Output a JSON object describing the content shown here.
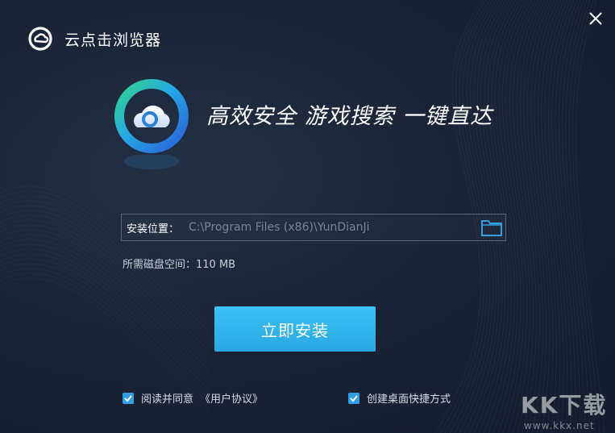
{
  "window": {
    "title": "云点击浏览器",
    "slogan": "高效安全  游戏搜索  一键直达"
  },
  "icons": {
    "app": "cloud-logo-icon",
    "close": "close-icon",
    "folder": "folder-icon",
    "check": "check-icon"
  },
  "install": {
    "path_label": "安装位置：",
    "path_value": "C:\\Program Files (x86)\\YunDianJi",
    "disk_space": "所需磁盘空间：110 MB",
    "button_label": "立即安装"
  },
  "agreement": {
    "checked": true,
    "label": "阅读并同意",
    "link": "《用户协议》"
  },
  "shortcut": {
    "checked": true,
    "label": "创建桌面快捷方式"
  },
  "watermark": {
    "logo_text": "KK下载",
    "url": "www.kkx.net"
  },
  "colors": {
    "background": "#1b2336",
    "accent": "#2aa7e3",
    "checkbox": "#2e9fe3"
  }
}
